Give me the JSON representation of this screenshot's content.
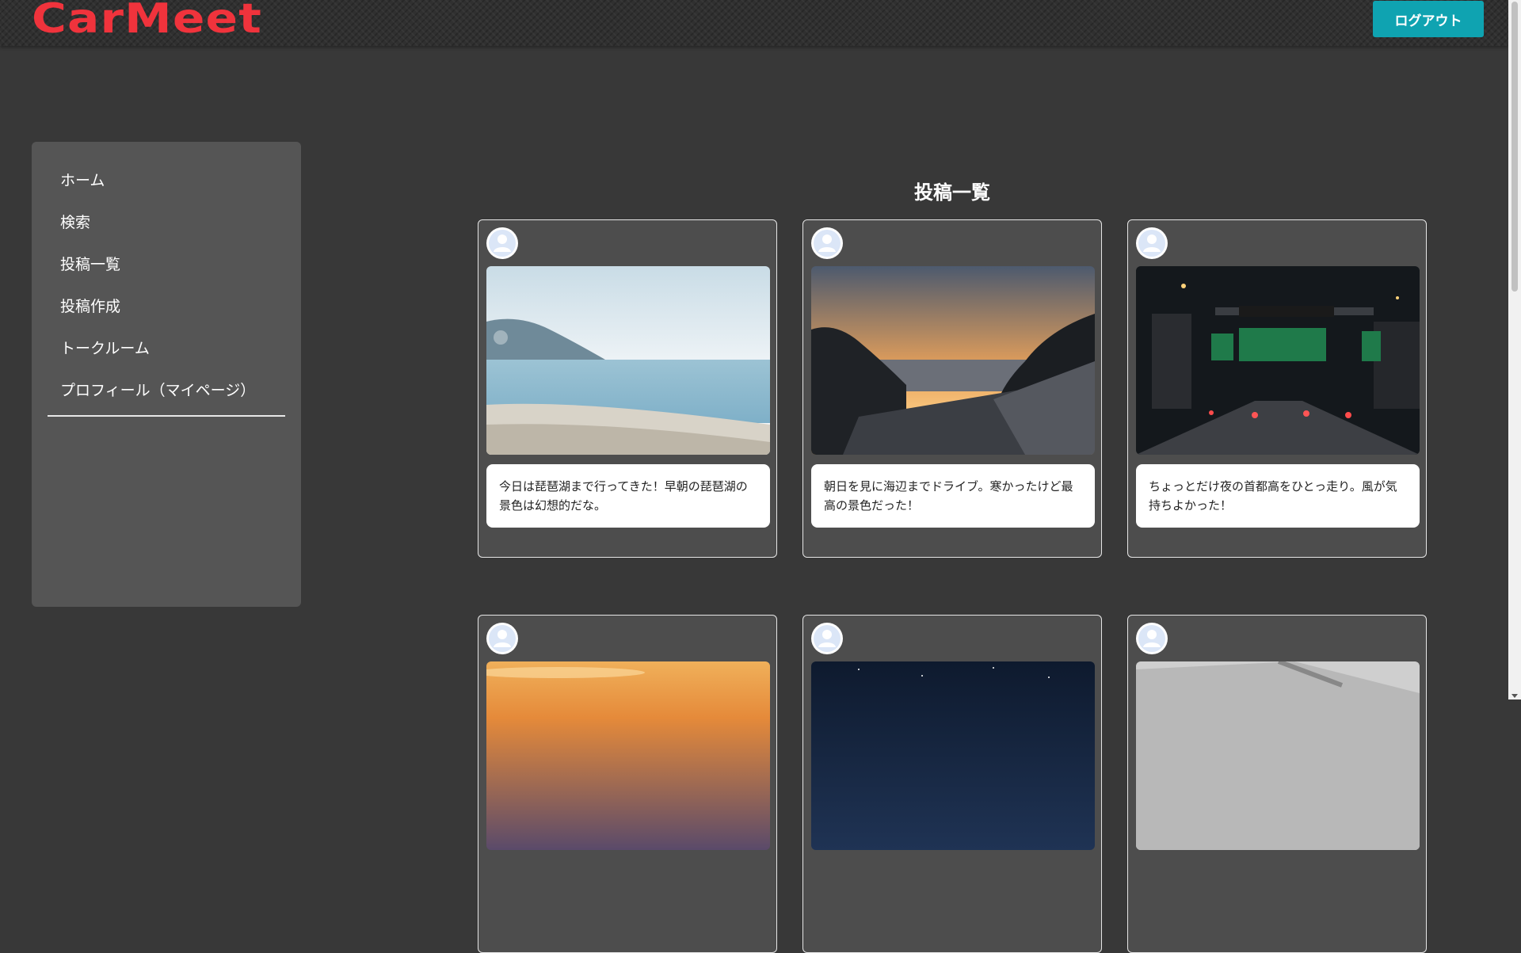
{
  "app": {
    "logo": "CarMeet"
  },
  "header": {
    "logout_label": "ログアウト"
  },
  "sidebar": {
    "items": [
      {
        "label": "ホーム"
      },
      {
        "label": "検索"
      },
      {
        "label": "投稿一覧"
      },
      {
        "label": "投稿作成"
      },
      {
        "label": "トークルーム"
      },
      {
        "label": "プロフィール（マイページ）"
      }
    ]
  },
  "main": {
    "title": "投稿一覧",
    "posts": [
      {
        "caption": "今日は琵琶湖まで行ってきた！早朝の琵琶湖の景色は幻想的だな。",
        "photo": "lake-beach-photo"
      },
      {
        "caption": "朝日を見に海辺までドライブ。寒かったけど最高の景色だった！",
        "photo": "sunrise-sea-photo"
      },
      {
        "caption": "ちょっとだけ夜の首都高をひとっ走り。風が気持ちよかった！",
        "photo": "night-expressway-photo"
      },
      {
        "caption": "",
        "photo": "sunset-clouds-photo"
      },
      {
        "caption": "",
        "photo": "starry-sky-photo"
      },
      {
        "caption": "",
        "photo": "car-detail-photo"
      }
    ]
  },
  "colors": {
    "background": "#383838",
    "accent": "#f0333c",
    "button": "#0fa3b1",
    "sidebar": "#555555",
    "card": "#4d4d4d"
  }
}
